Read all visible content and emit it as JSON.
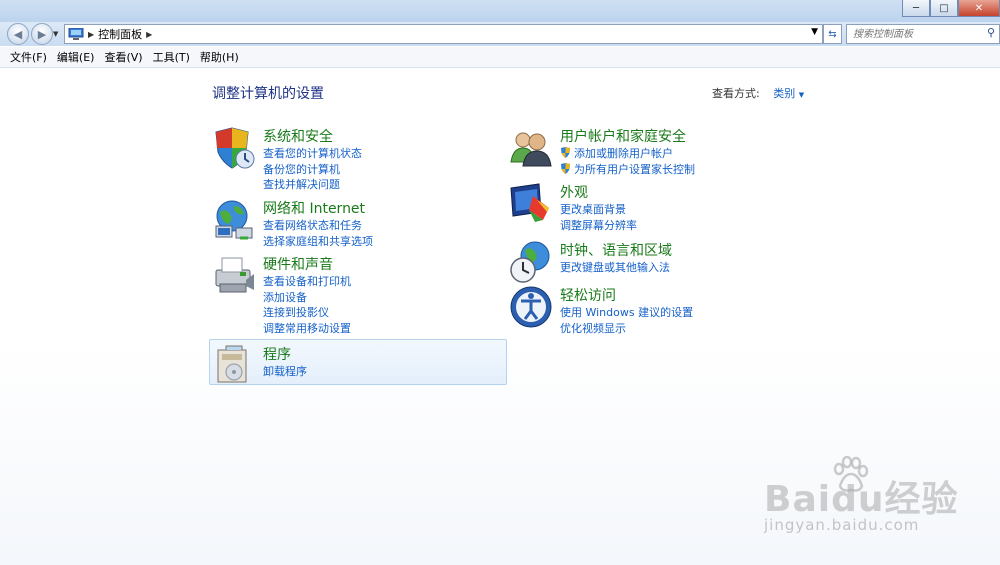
{
  "address": {
    "crumb": "控制面板"
  },
  "search": {
    "placeholder": "搜索控制面板"
  },
  "menu": [
    {
      "label": "文件(F)"
    },
    {
      "label": "编辑(E)"
    },
    {
      "label": "查看(V)"
    },
    {
      "label": "工具(T)"
    },
    {
      "label": "帮助(H)"
    }
  ],
  "page": {
    "title": "调整计算机的设置",
    "view_by_label": "查看方式:",
    "view_by_value": "类别"
  },
  "categories": {
    "system": {
      "title": "系统和安全",
      "links": [
        "查看您的计算机状态",
        "备份您的计算机",
        "查找并解决问题"
      ]
    },
    "network": {
      "title": "网络和 Internet",
      "links": [
        "查看网络状态和任务",
        "选择家庭组和共享选项"
      ]
    },
    "hardware": {
      "title": "硬件和声音",
      "links": [
        "查看设备和打印机",
        "添加设备",
        "连接到投影仪",
        "调整常用移动设置"
      ]
    },
    "programs": {
      "title": "程序",
      "links": [
        "卸载程序"
      ]
    },
    "users": {
      "title": "用户帐户和家庭安全",
      "links": [
        "添加或删除用户帐户",
        "为所有用户设置家长控制"
      ]
    },
    "appearance": {
      "title": "外观",
      "links": [
        "更改桌面背景",
        "调整屏幕分辨率"
      ]
    },
    "clock": {
      "title": "时钟、语言和区域",
      "links": [
        "更改键盘或其他输入法"
      ]
    },
    "ease": {
      "title": "轻松访问",
      "links": [
        "使用 Windows 建议的设置",
        "优化视频显示"
      ]
    }
  },
  "watermark": {
    "logo": "Baidu经验",
    "url": "jingyan.baidu.com"
  },
  "colors": {
    "category_title": "#197a19",
    "link": "#1561c9",
    "heading": "#1e3287"
  }
}
